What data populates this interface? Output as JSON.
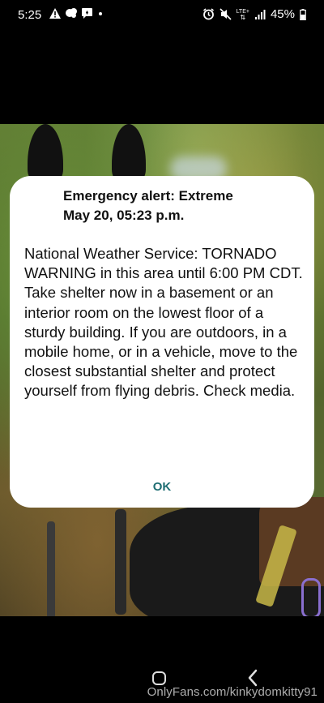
{
  "status_bar": {
    "time": "5:25",
    "left_icons": [
      "warning-icon",
      "notification-bubble-icon",
      "message-icon",
      "dot-icon"
    ],
    "right_icons": [
      "alarm-icon",
      "mute-icon",
      "lte-signal-icon",
      "signal-bars-icon",
      "battery-icon"
    ],
    "network_label": "LTE+",
    "battery_percent": "45%"
  },
  "alert_dialog": {
    "title_line1": "Emergency alert: Extreme",
    "title_line2": "May 20, 05:23 p.m.",
    "body": "National Weather Service: TORNADO WARNING in this area until 6:00 PM CDT. Take shelter now in a basement or an interior room on the lowest floor of a sturdy building. If you are outdoors, in a mobile home, or in a vehicle, move to the closest substantial shelter and protect yourself from flying debris. Check media.",
    "ok_label": "OK",
    "ok_color": "#1f6e73"
  },
  "nav_bar": {
    "buttons": [
      "home-icon",
      "back-icon"
    ]
  },
  "watermark": {
    "text": "OnlyFans.com/kinkydomkitty91"
  }
}
